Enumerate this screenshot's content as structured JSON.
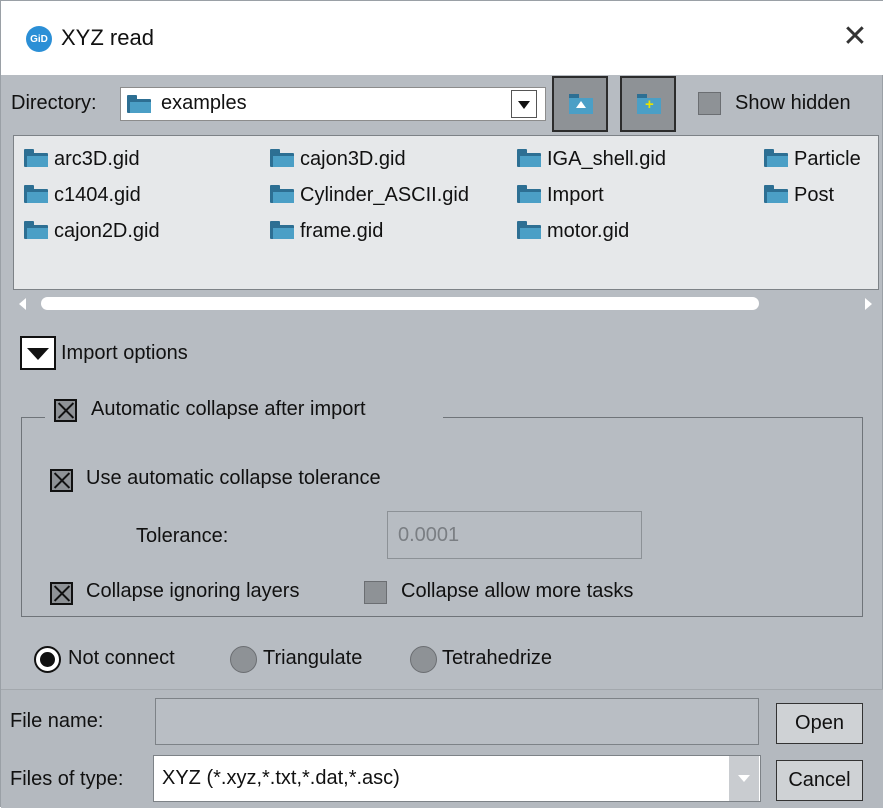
{
  "window": {
    "title": "XYZ read",
    "app_icon": "GiD",
    "close_glyph": "✕"
  },
  "toolbar": {
    "directory_label": "Directory:",
    "directory_value": "examples",
    "show_hidden_label": "Show hidden"
  },
  "files": [
    {
      "name": "arc3D.gid"
    },
    {
      "name": "c1404.gid"
    },
    {
      "name": "cajon2D.gid"
    },
    {
      "name": "cajon3D.gid"
    },
    {
      "name": "Cylinder_ASCII.gid"
    },
    {
      "name": "frame.gid"
    },
    {
      "name": "IGA_shell.gid"
    },
    {
      "name": "Import"
    },
    {
      "name": "motor.gid"
    },
    {
      "name": "Particle"
    },
    {
      "name": "Post"
    }
  ],
  "import_options": {
    "header": "Import options",
    "auto_collapse_label": "Automatic collapse after import",
    "use_tolerance_label": "Use automatic collapse tolerance",
    "tolerance_label": "Tolerance:",
    "tolerance_value": "0.0001",
    "ignore_layers_label": "Collapse ignoring layers",
    "allow_tasks_label": "Collapse allow more tasks",
    "auto_collapse_checked": true,
    "use_tolerance_checked": true,
    "ignore_layers_checked": true,
    "allow_tasks_checked": false
  },
  "connect": {
    "options": [
      "Not connect",
      "Triangulate",
      "Tetrahedrize"
    ],
    "selected": "Not connect"
  },
  "footer": {
    "file_name_label": "File name:",
    "file_name_value": "",
    "files_of_type_label": "Files of type:",
    "files_of_type_value": "XYZ (*.xyz,*.txt,*.dat,*.asc)",
    "open_label": "Open",
    "cancel_label": "Cancel"
  },
  "colors": {
    "window_bg": "#b7bcc2",
    "folder": "#4b9fc6",
    "accent": "#2b8fd6"
  }
}
